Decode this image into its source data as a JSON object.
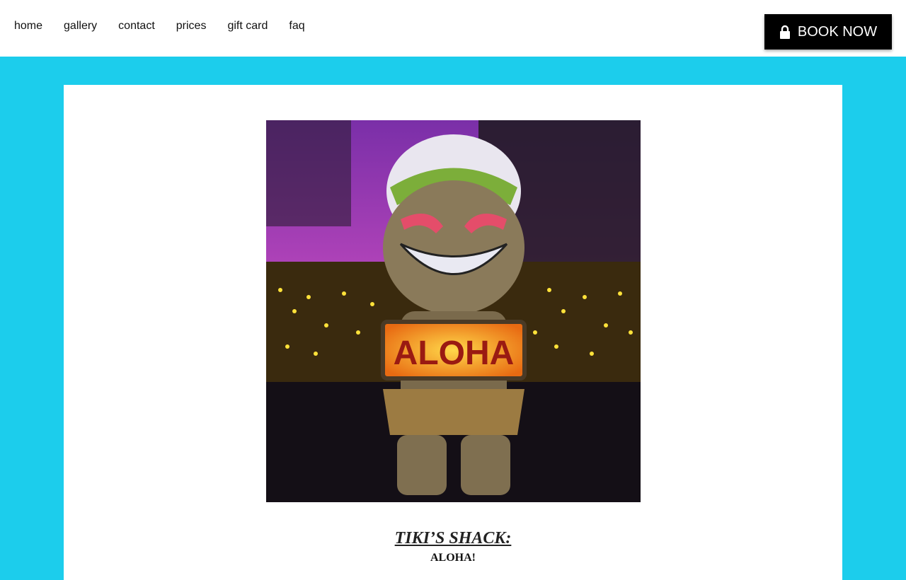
{
  "nav": {
    "items": [
      {
        "label": "home"
      },
      {
        "label": "gallery"
      },
      {
        "label": "contact"
      },
      {
        "label": "prices"
      },
      {
        "label": "gift card"
      },
      {
        "label": "faq"
      }
    ]
  },
  "header": {
    "book_button": {
      "label": "BOOK NOW",
      "icon": "lock-icon"
    }
  },
  "main": {
    "image": {
      "description_icon": "tiki-statue-image",
      "sign_text": "ALOHA"
    },
    "title": "TIKI’S SHACK:",
    "subtitle": "ALOHA!"
  },
  "colors": {
    "page_background": "#1ccdec",
    "header_background": "#ffffff",
    "button_background": "#000000",
    "button_text": "#ffffff"
  }
}
